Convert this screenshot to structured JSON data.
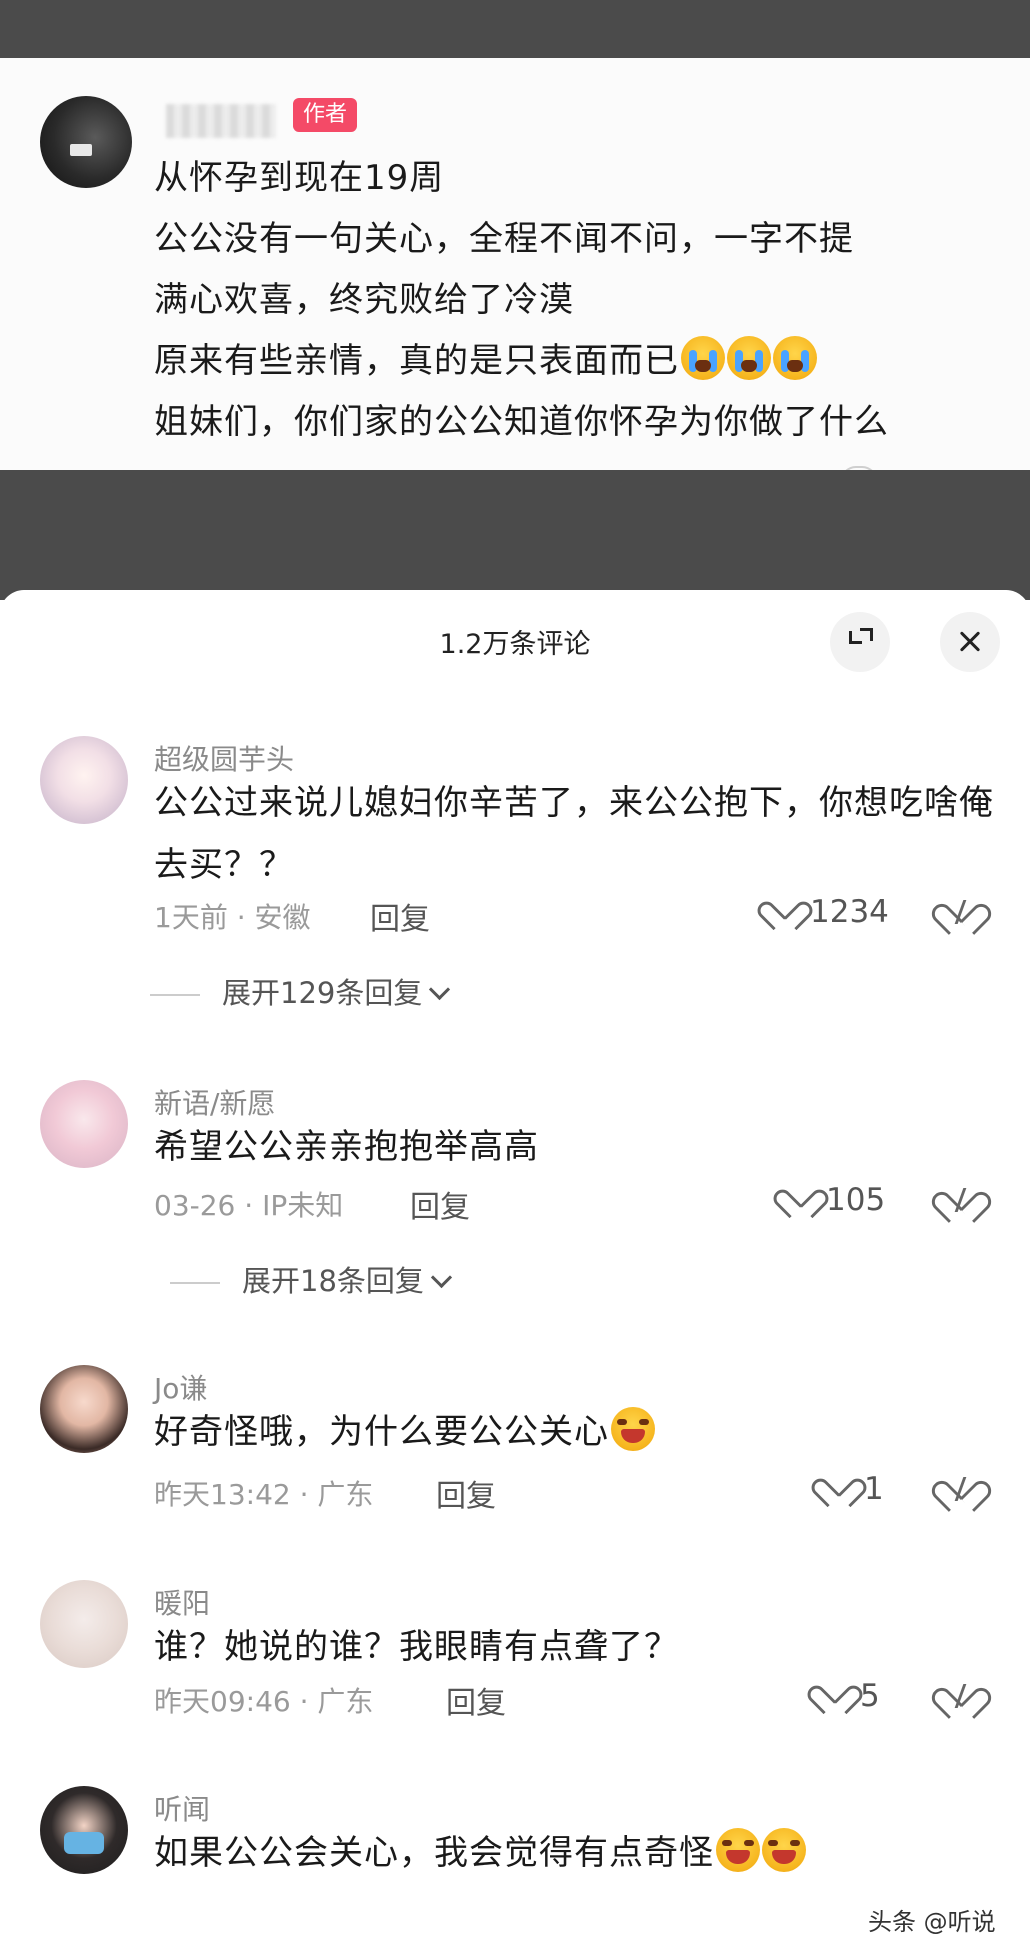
{
  "post": {
    "username": "...",
    "author_badge": "作者",
    "lines": [
      "从怀孕到现在19周",
      "公公没有一句关心，全程不闻不问，一字不提",
      "满心欢喜，终究败给了冷漠",
      "原来有些亲情，真的是只表面而已",
      "姐妹们，你们家的公公知道你怀孕为你做了什么"
    ],
    "emoji_line4": [
      "cry-emoji",
      "cry-emoji",
      "cry-emoji"
    ]
  },
  "comments_sheet": {
    "title": "1.2万条评论",
    "expand_icon": "expand-icon",
    "close_icon": "close-icon"
  },
  "comments": [
    {
      "user": "超级圆芋头",
      "text": "公公过来说儿媳妇你辛苦了，来公公抱下，你想吃啥俺去买？？",
      "time": "1天前",
      "location": "安徽",
      "reply": "回复",
      "likes": "1234",
      "expand": "展开129条回复"
    },
    {
      "user": "新语/新愿",
      "text": "希望公公亲亲抱抱举高高",
      "time": "03-26",
      "location": "IP未知",
      "reply": "回复",
      "likes": "105",
      "expand": "展开18条回复"
    },
    {
      "user": "Jo谦",
      "text": "好奇怪哦，为什么要公公关心",
      "time": "昨天13:42",
      "location": "广东",
      "reply": "回复",
      "likes": "1"
    },
    {
      "user": "暖阳",
      "text": "谁？她说的谁？我眼睛有点聋了？",
      "time": "昨天09:46",
      "location": "广东",
      "reply": "回复",
      "likes": "5"
    },
    {
      "user": "听闻",
      "text": "如果公公会关心，我会觉得有点奇怪"
    }
  ],
  "meta_separator": "·",
  "watermark": "头条 @听说"
}
